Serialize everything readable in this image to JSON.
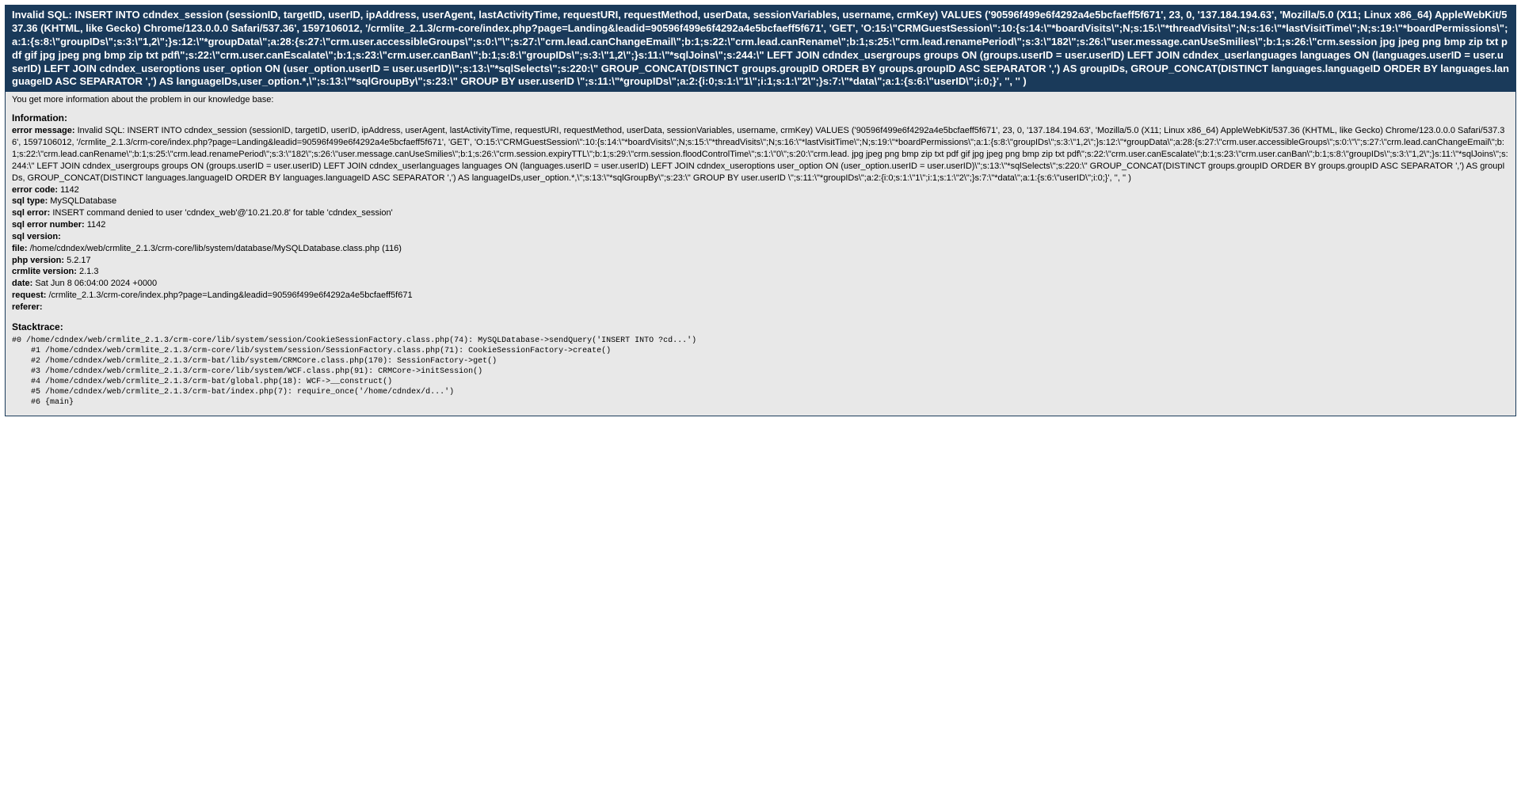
{
  "header": {
    "sql_error": "Invalid SQL: INSERT INTO cdndex_session (sessionID, targetID, userID, ipAddress, userAgent, lastActivityTime, requestURI, requestMethod, userData, sessionVariables, username, crmKey) VALUES ('90596f499e6f4292a4e5bcfaeff5f671', 23, 0, '137.184.194.63', 'Mozilla/5.0 (X11; Linux x86_64) AppleWebKit/537.36 (KHTML, like Gecko) Chrome/123.0.0.0 Safari/537.36', 1597106012, '/crmlite_2.1.3/crm-core/index.php?page=Landing&leadid=90596f499e6f4292a4e5bcfaeff5f671', 'GET', 'O:15:\\\"CRMGuestSession\\\":10:{s:14:\\\"*boardVisits\\\";N;s:15:\\\"*threadVisits\\\";N;s:16:\\\"*lastVisitTime\\\";N;s:19:\\\"*boardPermissions\\\";a:1:{s:8:\\\"groupIDs\\\";s:3:\\\"1,2\\\";}s:12:\\\"*groupData\\\";a:28:{s:27:\\\"crm.user.accessibleGroups\\\";s:0:\\\"\\\";s:27:\\\"crm.lead.canChangeEmail\\\";b:1;s:22:\\\"crm.lead.canRename\\\";b:1;s:25:\\\"crm.lead.renamePeriod\\\";s:3:\\\"182\\\";s:26:\\\"user.message.canUseSmilies\\\";b:1;s:26:\\\"crm.session jpg jpeg png bmp zip txt pdf gif jpg jpeg png bmp zip txt pdf\\\";s:22:\\\"crm.user.canEscalate\\\";b:1;s:23:\\\"crm.user.canBan\\\";b:1;s:8:\\\"groupIDs\\\";s:3:\\\"1,2\\\";}s:11:\\\"*sqlJoins\\\";s:244:\\\" LEFT JOIN cdndex_usergroups groups ON (groups.userID = user.userID) LEFT JOIN cdndex_userlanguages languages ON (languages.userID = user.userID) LEFT JOIN cdndex_useroptions user_option ON (user_option.userID = user.userID)\\\";s:13:\\\"*sqlSelects\\\";s:220:\\\" GROUP_CONCAT(DISTINCT groups.groupID ORDER BY groups.groupID ASC SEPARATOR ',') AS groupIDs, GROUP_CONCAT(DISTINCT languages.languageID ORDER BY languages.languageID ASC SEPARATOR ',') AS languageIDs,user_option.*,\\\";s:13:\\\"*sqlGroupBy\\\";s:23:\\\" GROUP BY user.userID \\\";s:11:\\\"*groupIDs\\\";a:2:{i:0;s:1:\\\"1\\\";i:1;s:1:\\\"2\\\";}s:7:\\\"*data\\\";a:1:{s:6:\\\"userID\\\";i:0;}', '', '' )"
  },
  "kb_text": "You get more information about the problem in our knowledge base:",
  "information": {
    "title": "Information:",
    "labels": {
      "error_message": "error message:",
      "error_code": "error code:",
      "sql_type": "sql type:",
      "sql_error": "sql error:",
      "sql_error_number": "sql error number:",
      "sql_version": "sql version:",
      "file": "file:",
      "php_version": "php version:",
      "crmlite_version": "crmlite version:",
      "date": "date:",
      "request": "request:",
      "referer": "referer:"
    },
    "values": {
      "error_message": "Invalid SQL: INSERT INTO cdndex_session (sessionID, targetID, userID, ipAddress, userAgent, lastActivityTime, requestURI, requestMethod, userData, sessionVariables, username, crmKey) VALUES ('90596f499e6f4292a4e5bcfaeff5f671', 23, 0, '137.184.194.63', 'Mozilla/5.0 (X11; Linux x86_64) AppleWebKit/537.36 (KHTML, like Gecko) Chrome/123.0.0.0 Safari/537.36', 1597106012, '/crmlite_2.1.3/crm-core/index.php?page=Landing&leadid=90596f499e6f4292a4e5bcfaeff5f671', 'GET', 'O:15:\\\"CRMGuestSession\\\":10:{s:14:\\\"*boardVisits\\\";N;s:15:\\\"*threadVisits\\\";N;s:16:\\\"*lastVisitTime\\\";N;s:19:\\\"*boardPermissions\\\";a:1:{s:8:\\\"groupIDs\\\";s:3:\\\"1,2\\\";}s:12:\\\"*groupData\\\";a:28:{s:27:\\\"crm.user.accessibleGroups\\\";s:0:\\\"\\\";s:27:\\\"crm.lead.canChangeEmail\\\";b:1;s:22:\\\"crm.lead.canRename\\\";b:1;s:25:\\\"crm.lead.renamePeriod\\\";s:3:\\\"182\\\";s:26:\\\"user.message.canUseSmilies\\\";b:1;s:26:\\\"crm.session.expiryTTL\\\";b:1;s:29:\\\"crm.session.floodControlTime\\\";s:1:\\\"0\\\";s:20:\\\"crm.lead. jpg jpeg png bmp zip txt pdf gif jpg jpeg png bmp zip txt pdf\\\";s:22:\\\"crm.user.canEscalate\\\";b:1;s:23:\\\"crm.user.canBan\\\";b:1;s:8:\\\"groupIDs\\\";s:3:\\\"1,2\\\";}s:11:\\\"*sqlJoins\\\";s:244:\\\" LEFT JOIN cdndex_usergroups groups ON (groups.userID = user.userID) LEFT JOIN cdndex_userlanguages languages ON (languages.userID = user.userID) LEFT JOIN cdndex_useroptions user_option ON (user_option.userID = user.userID)\\\";s:13:\\\"*sqlSelects\\\";s:220:\\\" GROUP_CONCAT(DISTINCT groups.groupID ORDER BY groups.groupID ASC SEPARATOR ',') AS groupIDs, GROUP_CONCAT(DISTINCT languages.languageID ORDER BY languages.languageID ASC SEPARATOR ',') AS languageIDs,user_option.*,\\\";s:13:\\\"*sqlGroupBy\\\";s:23:\\\" GROUP BY user.userID \\\";s:11:\\\"*groupIDs\\\";a:2:{i:0;s:1:\\\"1\\\";i:1;s:1:\\\"2\\\";}s:7:\\\"*data\\\";a:1:{s:6:\\\"userID\\\";i:0;}', '', '' )",
      "error_code": "1142",
      "sql_type": "MySQLDatabase",
      "sql_error": "INSERT command denied to user 'cdndex_web'@'10.21.20.8' for table 'cdndex_session'",
      "sql_error_number": "1142",
      "sql_version": "",
      "file": "/home/cdndex/web/crmlite_2.1.3/crm-core/lib/system/database/MySQLDatabase.class.php (116)",
      "php_version": "5.2.17",
      "crmlite_version": "2.1.3",
      "date": "Sat Jun 8 06:04:00 2024 +0000",
      "request": "/crmlite_2.1.3/crm-core/index.php?page=Landing&leadid=90596f499e6f4292a4e5bcfaeff5f671",
      "referer": ""
    }
  },
  "stacktrace": {
    "title": "Stacktrace:",
    "trace": "#0 /home/cdndex/web/crmlite_2.1.3/crm-core/lib/system/session/CookieSessionFactory.class.php(74): MySQLDatabase->sendQuery('INSERT INTO ?cd...')\n    #1 /home/cdndex/web/crmlite_2.1.3/crm-core/lib/system/session/SessionFactory.class.php(71): CookieSessionFactory->create()\n    #2 /home/cdndex/web/crmlite_2.1.3/crm-bat/lib/system/CRMCore.class.php(170): SessionFactory->get()\n    #3 /home/cdndex/web/crmlite_2.1.3/crm-core/lib/system/WCF.class.php(91): CRMCore->initSession()\n    #4 /home/cdndex/web/crmlite_2.1.3/crm-bat/global.php(18): WCF->__construct()\n    #5 /home/cdndex/web/crmlite_2.1.3/crm-bat/index.php(7): require_once('/home/cdndex/d...')\n    #6 {main}"
  }
}
